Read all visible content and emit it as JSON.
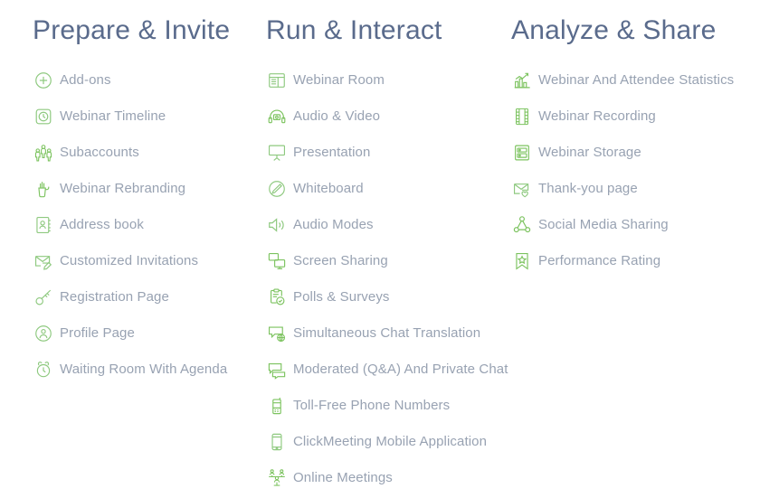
{
  "theme": {
    "background": "#ffffff",
    "heading_color": "#5a6b8c",
    "label_color": "#98a2b2",
    "icon_color": "#8ec97f",
    "icon_color_strong": "#7cc35f"
  },
  "columns": [
    {
      "heading": "Prepare & Invite",
      "items": [
        {
          "label": "Add-ons",
          "icon": "plus-circle-icon"
        },
        {
          "label": "Webinar Timeline",
          "icon": "clock-square-icon"
        },
        {
          "label": "Subaccounts",
          "icon": "people-group-icon"
        },
        {
          "label": "Webinar Rebranding",
          "icon": "paint-cup-icon"
        },
        {
          "label": "Address book",
          "icon": "address-book-icon"
        },
        {
          "label": "Customized Invitations",
          "icon": "envelope-pencil-icon"
        },
        {
          "label": "Registration Page",
          "icon": "key-icon"
        },
        {
          "label": "Profile Page",
          "icon": "user-circle-icon"
        },
        {
          "label": "Waiting Room With Agenda",
          "icon": "alarm-clock-icon"
        }
      ]
    },
    {
      "heading": "Run & Interact",
      "items": [
        {
          "label": "Webinar Room",
          "icon": "window-layout-icon"
        },
        {
          "label": "Audio & Video",
          "icon": "headset-icon"
        },
        {
          "label": "Presentation",
          "icon": "projector-screen-icon"
        },
        {
          "label": "Whiteboard",
          "icon": "pencil-circle-icon"
        },
        {
          "label": "Audio Modes",
          "icon": "speaker-icon"
        },
        {
          "label": "Screen Sharing",
          "icon": "screen-share-icon"
        },
        {
          "label": "Polls & Surveys",
          "icon": "clipboard-check-icon"
        },
        {
          "label": "Simultaneous Chat Translation",
          "icon": "chat-globe-icon"
        },
        {
          "label": "Moderated (Q&A) And Private Chat",
          "icon": "chat-bubbles-icon"
        },
        {
          "label": "Toll-Free Phone Numbers",
          "icon": "phone-icon"
        },
        {
          "label": "ClickMeeting Mobile Application",
          "icon": "mobile-icon"
        },
        {
          "label": "Online Meetings",
          "icon": "meeting-people-icon"
        }
      ]
    },
    {
      "heading": "Analyze & Share",
      "items": [
        {
          "label": "Webinar And Attendee Statistics",
          "icon": "bar-chart-trend-icon"
        },
        {
          "label": "Webinar Recording",
          "icon": "film-strip-icon"
        },
        {
          "label": "Webinar Storage",
          "icon": "server-storage-icon"
        },
        {
          "label": "Thank-you page",
          "icon": "envelope-heart-icon"
        },
        {
          "label": "Social Media Sharing",
          "icon": "share-nodes-icon"
        },
        {
          "label": "Performance Rating",
          "icon": "ribbon-star-icon"
        }
      ]
    }
  ]
}
